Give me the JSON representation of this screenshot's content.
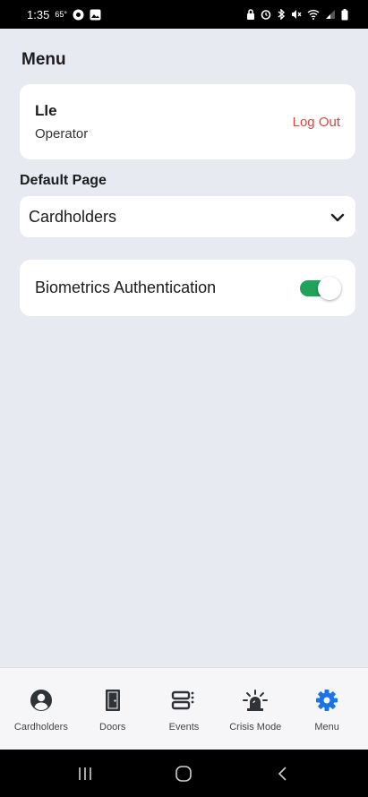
{
  "status_bar": {
    "time": "1:35",
    "temperature": "65°"
  },
  "page": {
    "title": "Menu"
  },
  "user": {
    "name": "Lle",
    "role": "Operator",
    "logout_label": "Log Out"
  },
  "default_page": {
    "label": "Default Page",
    "selected": "Cardholders"
  },
  "biometrics": {
    "label": "Biometrics Authentication",
    "enabled": true
  },
  "bottom_nav": {
    "items": [
      {
        "label": "Cardholders",
        "icon": "person-circle-icon",
        "active": false
      },
      {
        "label": "Doors",
        "icon": "door-icon",
        "active": false
      },
      {
        "label": "Events",
        "icon": "events-icon",
        "active": false
      },
      {
        "label": "Crisis Mode",
        "icon": "alarm-icon",
        "active": false
      },
      {
        "label": "Menu",
        "icon": "gear-icon",
        "active": true
      }
    ]
  },
  "colors": {
    "accent": "#1a73e8",
    "logout": "#d9483f",
    "toggle_on": "#1fa35a",
    "background": "#e8eaf2"
  }
}
